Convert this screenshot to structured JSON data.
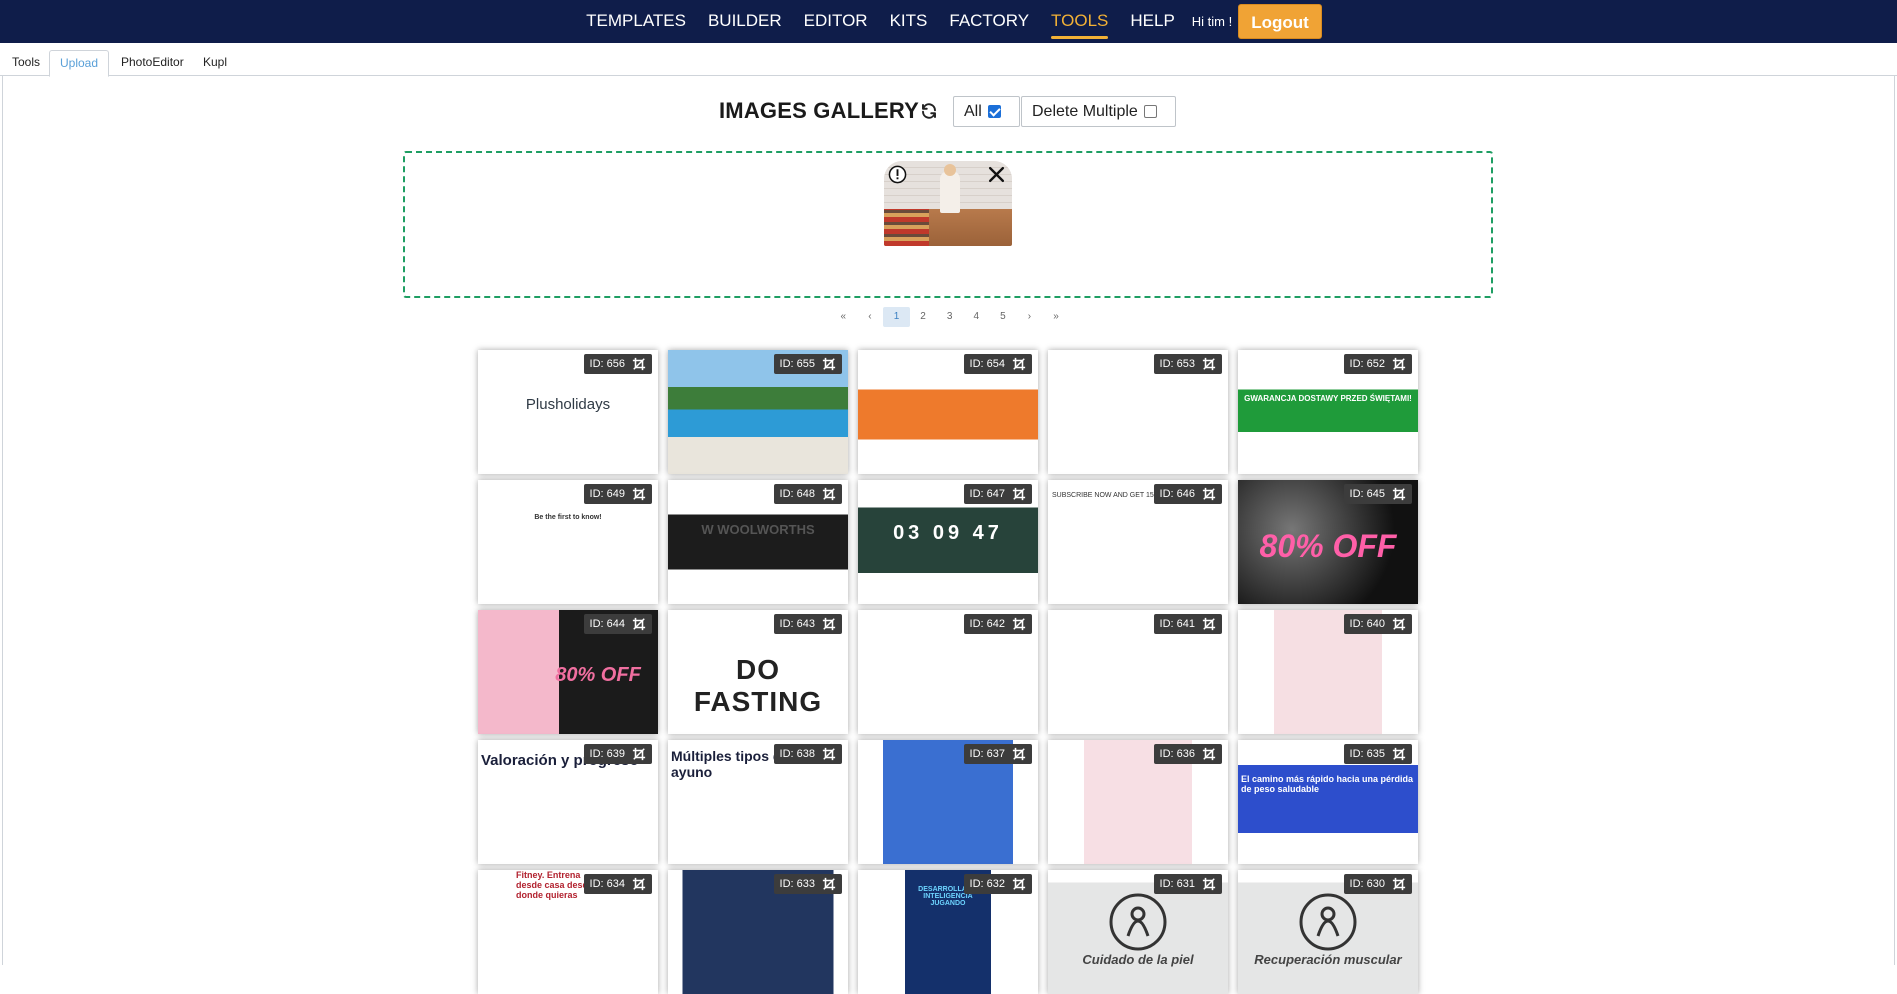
{
  "nav": {
    "items": [
      {
        "label": "TEMPLATES",
        "active": false
      },
      {
        "label": "BUILDER",
        "active": false
      },
      {
        "label": "EDITOR",
        "active": false
      },
      {
        "label": "KITS",
        "active": false
      },
      {
        "label": "FACTORY",
        "active": false
      },
      {
        "label": "TOOLS",
        "active": true
      },
      {
        "label": "HELP",
        "active": false
      }
    ],
    "greeting": "Hi tim !",
    "logout_label": "Logout"
  },
  "subtabs": [
    {
      "label": "Tools",
      "active": false
    },
    {
      "label": "Upload",
      "active": true
    },
    {
      "label": "PhotoEditor",
      "active": false
    },
    {
      "label": "Kupl",
      "active": false
    }
  ],
  "gallery": {
    "title": "IMAGES GALLERY",
    "filter_all_label": "All",
    "filter_all_checked": true,
    "delete_multiple_label": "Delete Multiple",
    "delete_multiple_checked": false
  },
  "pagination": {
    "first": "«",
    "prev": "‹",
    "pages": [
      "1",
      "2",
      "3",
      "4",
      "5"
    ],
    "current": "1",
    "next": "›",
    "last": "»"
  },
  "tiles": [
    {
      "id": "ID: 656",
      "text": "Plusholidays",
      "style": "logo"
    },
    {
      "id": "ID: 655",
      "text": "",
      "style": "pool"
    },
    {
      "id": "ID: 654",
      "text": "",
      "style": "orange"
    },
    {
      "id": "ID: 653",
      "text": "",
      "style": "blank"
    },
    {
      "id": "ID: 652",
      "text": "GWARANCJA DOSTAWY PRZED ŚWIĘTAMI!",
      "style": "green"
    },
    {
      "id": "ID: 649",
      "text": "Be the first to know!",
      "style": "form"
    },
    {
      "id": "ID: 648",
      "text": "W WOOLWORTHS",
      "style": "dark"
    },
    {
      "id": "ID: 647",
      "text": "03 09 47",
      "style": "countdown"
    },
    {
      "id": "ID: 646",
      "text": "SUBSCRIBE NOW AND GET 15% OFF",
      "style": "subscribe"
    },
    {
      "id": "ID: 645",
      "text": "80% OFF",
      "style": "cyber"
    },
    {
      "id": "ID: 644",
      "text": "80% OFF",
      "style": "pinkoff"
    },
    {
      "id": "ID: 643",
      "text": "DO FASTING",
      "style": "fasting"
    },
    {
      "id": "ID: 642",
      "text": "",
      "style": "icons"
    },
    {
      "id": "ID: 641",
      "text": "",
      "style": "icons"
    },
    {
      "id": "ID: 640",
      "text": "",
      "style": "phonepink"
    },
    {
      "id": "ID: 639",
      "text": "Valoración y progreso",
      "style": "doc"
    },
    {
      "id": "ID: 638",
      "text": "Múltiples tipos de ayuno",
      "style": "doc2"
    },
    {
      "id": "ID: 637",
      "text": "",
      "style": "phoneblue"
    },
    {
      "id": "ID: 636",
      "text": "",
      "style": "phonepink2"
    },
    {
      "id": "ID: 635",
      "text": "El camino más rápido hacia una pérdida de peso saludable",
      "style": "bluebanner"
    },
    {
      "id": "ID: 634",
      "text": "Fitney. Entrena desde casa desde donde quieras",
      "style": "fitney"
    },
    {
      "id": "ID: 633",
      "text": "",
      "style": "brain"
    },
    {
      "id": "ID: 632",
      "text": "DESARROLLA TU INTELIGENCIA JUGANDO",
      "style": "navy"
    },
    {
      "id": "ID: 631",
      "text": "Cuidado de la piel",
      "style": "grey"
    },
    {
      "id": "ID: 630",
      "text": "Recuperación muscular",
      "style": "grey"
    }
  ]
}
